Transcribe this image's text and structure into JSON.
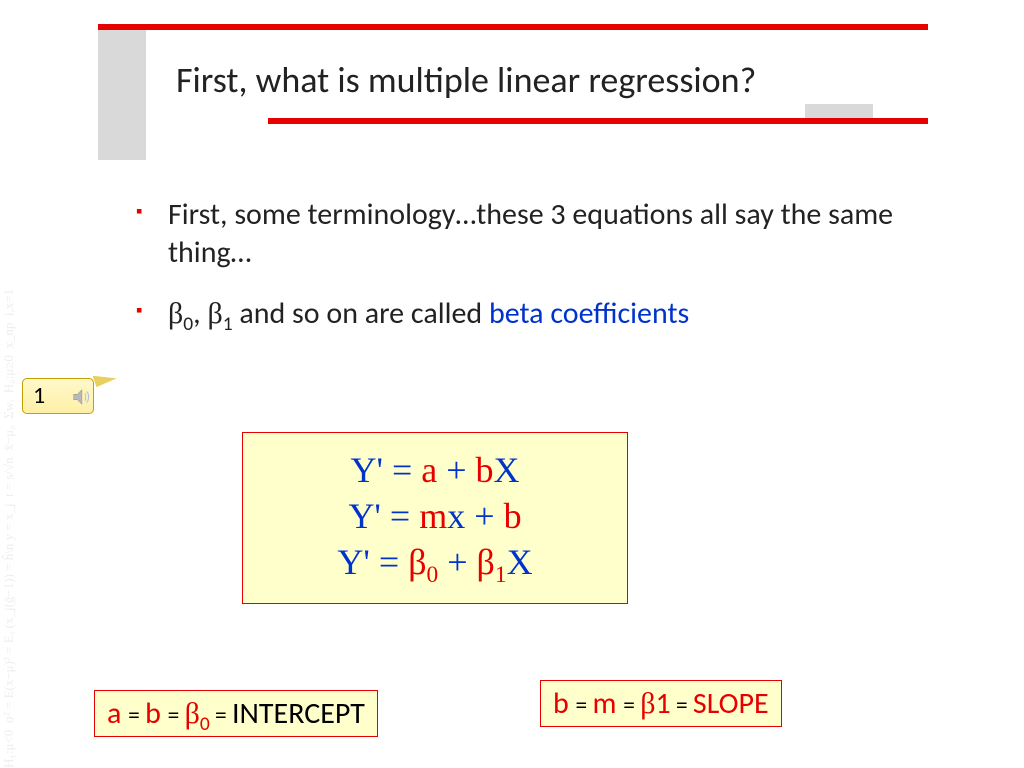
{
  "title": "First, what is multiple linear regression?",
  "bullets": {
    "b1": "First, some terminology…these 3 equations all say the same thing…",
    "b2_prefix_beta0": "β",
    "b2_sub0": "0",
    "b2_comma": ", ",
    "b2_prefix_beta1": "β",
    "b2_sub1": "1",
    "b2_rest": " and so on are called ",
    "b2_blue": "beta coefficients"
  },
  "callout": {
    "label": "1"
  },
  "equations": {
    "r1": {
      "y": "Y' = ",
      "a": "a",
      "plus": " + ",
      "b": "b",
      "x": "X"
    },
    "r2": {
      "y": "Y' = ",
      "m": "m",
      "x": "x",
      "plus": " + ",
      "b": "b"
    },
    "r3": {
      "y": "Y' = ",
      "beta": "β",
      "sub0": "0",
      "plus": " + ",
      "beta2": "β",
      "sub1": "1",
      "x": "X"
    }
  },
  "boxes": {
    "intercept": {
      "a": "a ",
      "eq1": "= ",
      "b": "b ",
      "eq2": "= ",
      "beta": "β",
      "sub0": "0",
      "eq3": " = ",
      "word": "INTERCEPT"
    },
    "slope": {
      "b": "b ",
      "eq1": "= ",
      "m": "m ",
      "eq2": "= ",
      "beta": "β",
      "sub1": "1",
      "eq3": " = ",
      "word": "SLOPE"
    }
  },
  "bg_math": "H₁:μ<0  σ² = E(x−μ)² = Eₓ (x_j(ĝ−1)) = ĥ\\n y = x_j  t = s/√n  x̄−μ₀  Σwᵢ  H₀:μ≥0  x_np  i,x=1"
}
